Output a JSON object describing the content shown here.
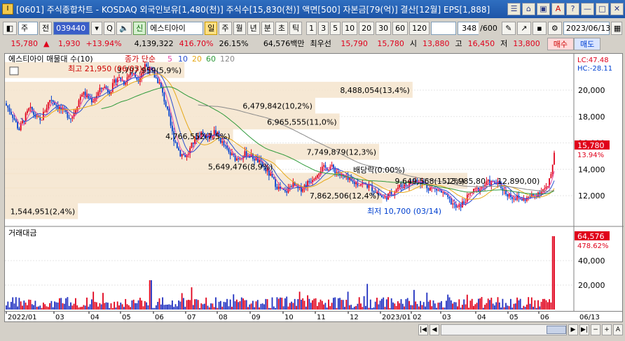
{
  "title": "[0601] 주식종합차트 - KOSDAQ 외국인보유[1,480(천)] 주식수[15,830(천)] 액면[500] 자본금[79(억)] 결산[12월] EPS[1,888]",
  "window_buttons": [
    "☰",
    "⌂",
    "▣",
    "A",
    "?",
    "—",
    "□",
    "✕"
  ],
  "toolbar": {
    "market": "주",
    "period_btn": "전",
    "code": "039440",
    "mode": "신",
    "name": "에스티아이",
    "periods": [
      "일",
      "주",
      "월",
      "년",
      "분",
      "초",
      "틱"
    ],
    "active_period": "일",
    "minutes": [
      "1",
      "3",
      "5",
      "10",
      "20",
      "30",
      "60",
      "120"
    ],
    "count": "348",
    "count_total": "/600",
    "date": "2023/06/13"
  },
  "quote": {
    "price": "15,780",
    "arrow": "▲",
    "change": "1,930",
    "pct": "+13.94%",
    "volume": "4,139,322",
    "vol_ratio": "416.70%",
    "turnover": "26.15%",
    "amount": "64,576백만",
    "best_label": "최우선",
    "ask": "15,790",
    "bid": "15,780",
    "open_label": "시",
    "open": "13,880",
    "high_label": "고",
    "high": "16,450",
    "low_label": "저",
    "low": "13,800",
    "buy": "매수",
    "sell": "매도"
  },
  "legend": {
    "name": "에스티아이 매물대 수(10)",
    "price_label": "종가 단순",
    "ma": [
      "5",
      "10",
      "20",
      "60",
      "120"
    ],
    "ma_colors": [
      "#e64aa6",
      "#2a4fd0",
      "#e6a817",
      "#2e9a3a",
      "#8a8a8a"
    ]
  },
  "right_labels": {
    "lc": "LC:47.48",
    "hc": "HC:-28.11",
    "price_box": "15,780",
    "pct": "13.94%",
    "vol_box": "64,576",
    "vol_pct": "478.62%",
    "last_date": "06/13"
  },
  "annotations": {
    "high": "최고 21,950 (06/03)",
    "low": "최저 10,700 (03/14)",
    "dividend": "배당락(0.00%)"
  },
  "volume_label": "거래대금",
  "chart_data": {
    "type": "candlestick",
    "y_ticks": [
      12000,
      14000,
      16000,
      18000,
      20000
    ],
    "vol_ticks": [
      "20,000",
      "40,000"
    ],
    "x_ticks": [
      "2022/01",
      "03",
      "04",
      "05",
      "06",
      "07",
      "08",
      "09",
      "10",
      "11",
      "12",
      "2023/01",
      "02",
      "03",
      "04",
      "05",
      "06"
    ],
    "volume_profile": [
      {
        "text": "3,797,959(5,9%)",
        "price": 21500,
        "pct": 5.9
      },
      {
        "text": "8,488,054(13,4%)",
        "price": 20000,
        "pct": 13.4
      },
      {
        "text": "6,479,842(10,2%)",
        "price": 18800,
        "pct": 10.2
      },
      {
        "text": "6,965,555(11,0%)",
        "price": 17600,
        "pct": 11.0
      },
      {
        "text": "4,766,552(7,5%)",
        "price": 16500,
        "pct": 7.5
      },
      {
        "text": "7,749,879(12,3%)",
        "price": 15300,
        "pct": 12.3
      },
      {
        "text": "5,649,476(8,9%)",
        "price": 14200,
        "pct": 8.9
      },
      {
        "text": "9,649,568(15,2%)",
        "price": 13100,
        "pct": 15.2
      },
      {
        "text": "7,862,506(12,4%)",
        "price": 12000,
        "pct": 12.4
      },
      {
        "text": "1,544,951(2,4%)",
        "price": 10800,
        "pct": 2.4
      }
    ],
    "extra_labels": [
      "13,985,80",
      "12,890,00)"
    ],
    "close_path": [
      [
        0,
        19000
      ],
      [
        10,
        18200
      ],
      [
        20,
        17000
      ],
      [
        35,
        18600
      ],
      [
        50,
        17600
      ],
      [
        65,
        19400
      ],
      [
        80,
        18500
      ],
      [
        95,
        17900
      ],
      [
        110,
        19800
      ],
      [
        125,
        19200
      ],
      [
        140,
        20300
      ],
      [
        150,
        19900
      ],
      [
        160,
        21000
      ],
      [
        170,
        20600
      ],
      [
        180,
        21400
      ],
      [
        190,
        20800
      ],
      [
        200,
        21950
      ],
      [
        210,
        21300
      ],
      [
        220,
        20600
      ],
      [
        230,
        18800
      ],
      [
        240,
        16500
      ],
      [
        250,
        15200
      ],
      [
        260,
        15000
      ],
      [
        270,
        16200
      ],
      [
        280,
        16800
      ],
      [
        290,
        16400
      ],
      [
        300,
        16900
      ],
      [
        310,
        16000
      ],
      [
        320,
        15200
      ],
      [
        330,
        14800
      ],
      [
        345,
        15200
      ],
      [
        360,
        14700
      ],
      [
        375,
        13800
      ],
      [
        390,
        12600
      ],
      [
        400,
        12200
      ],
      [
        410,
        12900
      ],
      [
        420,
        12400
      ],
      [
        435,
        13100
      ],
      [
        450,
        14000
      ],
      [
        465,
        14200
      ],
      [
        480,
        13500
      ],
      [
        495,
        13000
      ],
      [
        510,
        12900
      ],
      [
        520,
        12700
      ],
      [
        530,
        12300
      ],
      [
        540,
        11800
      ],
      [
        550,
        12100
      ],
      [
        560,
        12600
      ],
      [
        575,
        12900
      ],
      [
        590,
        13200
      ],
      [
        605,
        12600
      ],
      [
        620,
        12400
      ],
      [
        635,
        11600
      ],
      [
        645,
        11000
      ],
      [
        655,
        11500
      ],
      [
        665,
        12200
      ],
      [
        675,
        12500
      ],
      [
        690,
        13000
      ],
      [
        705,
        12900
      ],
      [
        715,
        12200
      ],
      [
        725,
        11900
      ],
      [
        740,
        11700
      ],
      [
        755,
        12000
      ],
      [
        765,
        12400
      ],
      [
        775,
        12600
      ],
      [
        780,
        13800
      ],
      [
        785,
        15780
      ]
    ]
  }
}
